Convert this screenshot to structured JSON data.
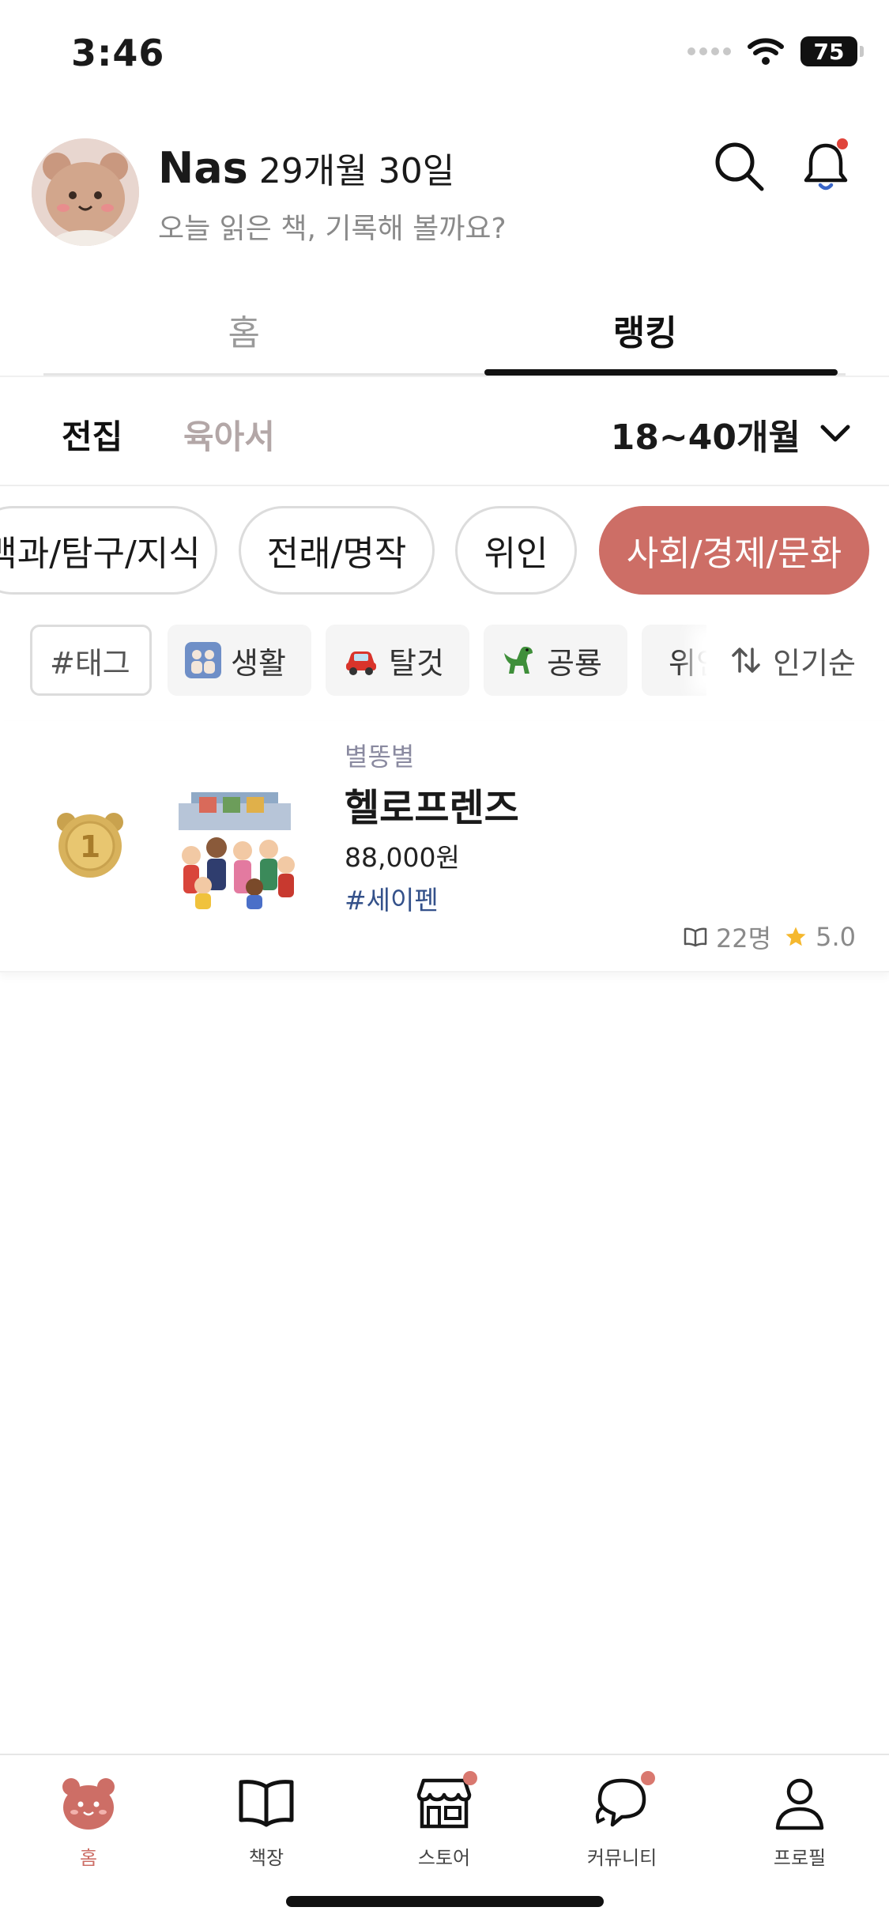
{
  "status_bar": {
    "time": "3:46",
    "battery": "75"
  },
  "header": {
    "user_name": "Nas",
    "age": "29개월 30일",
    "subtitle": "오늘 읽은 책, 기록해 볼까요?"
  },
  "tabs": [
    {
      "label": "홈",
      "active": false
    },
    {
      "label": "랭킹",
      "active": true
    }
  ],
  "sub_tabs": [
    {
      "label": "전집",
      "active": true
    },
    {
      "label": "육아서",
      "active": false
    }
  ],
  "age_filter": {
    "selected": "18~40개월"
  },
  "categories": [
    {
      "label": "백과/탐구/지식",
      "active": false
    },
    {
      "label": "전래/명작",
      "active": false
    },
    {
      "label": "위인",
      "active": false
    },
    {
      "label": "사회/경제/문화",
      "active": true
    }
  ],
  "tags": {
    "input_placeholder": "#태그",
    "items": [
      {
        "label": "생활",
        "icon": "family-emoji-icon"
      },
      {
        "label": "탈것",
        "icon": "car-emoji-icon"
      },
      {
        "label": "공룡",
        "icon": "dinosaur-emoji-icon"
      },
      {
        "label": "위인",
        "icon": "person-emoji-icon"
      }
    ]
  },
  "sort": {
    "label": "인기순"
  },
  "ranking": [
    {
      "rank": 1,
      "publisher": "별똥별",
      "title": "헬로프렌즈",
      "price": "88,000원",
      "hashtag": "#세이펜",
      "readers": "22명",
      "rating": "5.0"
    }
  ],
  "bottom_nav": [
    {
      "label": "홈",
      "icon": "bear-icon",
      "active": true,
      "badge": false
    },
    {
      "label": "책장",
      "icon": "book-icon",
      "active": false,
      "badge": false
    },
    {
      "label": "스토어",
      "icon": "store-icon",
      "active": false,
      "badge": true
    },
    {
      "label": "커뮤니티",
      "icon": "chat-icon",
      "active": false,
      "badge": true
    },
    {
      "label": "프로필",
      "icon": "profile-icon",
      "active": false,
      "badge": false
    }
  ],
  "colors": {
    "accent": "#cd6e66",
    "badge": "#d9786f",
    "notification_dot": "#e0443b",
    "star": "#f5b82e",
    "hashtag": "#34518a"
  }
}
